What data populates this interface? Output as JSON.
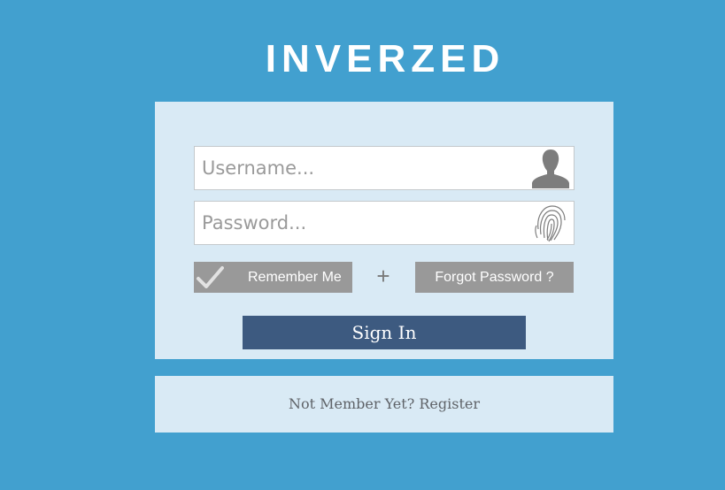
{
  "brand": {
    "logo_text": "INVERZED"
  },
  "login": {
    "username": {
      "placeholder": "Username...",
      "value": ""
    },
    "password": {
      "placeholder": "Password...",
      "value": ""
    },
    "remember_label": "Remember Me",
    "plus_symbol": "+",
    "forgot_label": "Forgot Password ?",
    "signin_label": "Sign In"
  },
  "register": {
    "text": "Not Member Yet? Register"
  },
  "icons": {
    "user": "user-silhouette-icon",
    "password": "fingerprint-icon",
    "remember": "checkmark-icon"
  },
  "colors": {
    "background": "#42a0cf",
    "card": "#d9eaf5",
    "gray_button": "#999999",
    "signin_button": "#3d5a80"
  }
}
